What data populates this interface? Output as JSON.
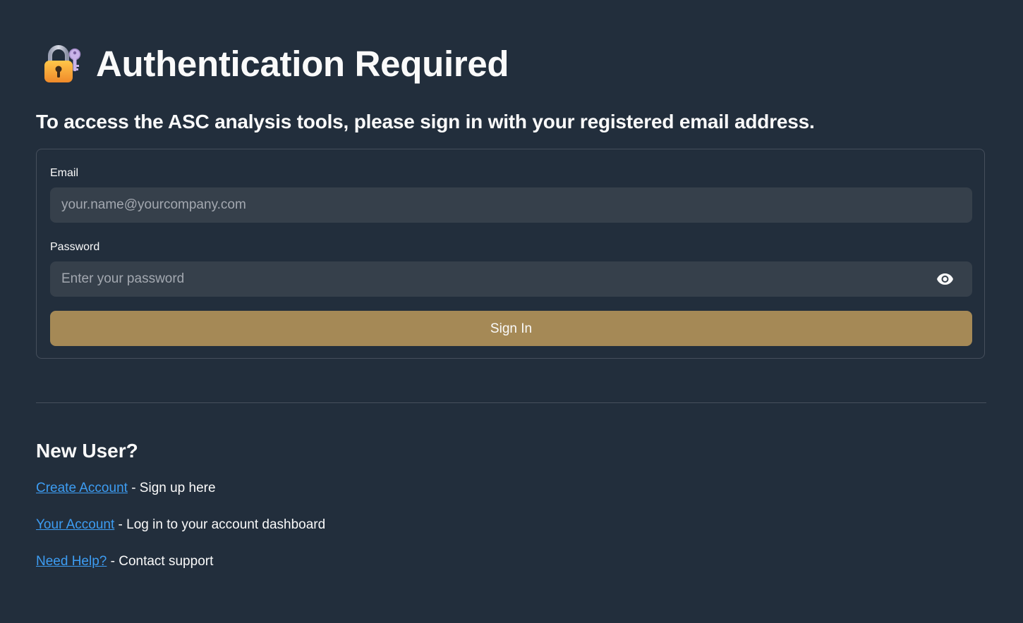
{
  "page": {
    "title": "Authentication Required",
    "title_icon": "locked-with-key-icon",
    "subtitle": "To access the ASC analysis tools, please sign in with your registered email address."
  },
  "form": {
    "email_label": "Email",
    "email_placeholder": "your.name@yourcompany.com",
    "email_value": "",
    "password_label": "Password",
    "password_placeholder": "Enter your password",
    "password_value": "",
    "password_toggle_icon": "eye-icon",
    "submit_label": "Sign In"
  },
  "new_user": {
    "heading": "New User?",
    "links": [
      {
        "link_text": "Create Account",
        "description": " - Sign up here"
      },
      {
        "link_text": "Your Account",
        "description": " - Log in to your account dashboard"
      },
      {
        "link_text": "Need Help?",
        "description": " - Contact support"
      }
    ]
  },
  "colors": {
    "background": "#222e3c",
    "input_background": "#36404b",
    "button_accent": "#a58956",
    "link": "#3d9df3",
    "text": "#fafafa",
    "placeholder": "#a3a8b0",
    "border": "#464f5c"
  }
}
